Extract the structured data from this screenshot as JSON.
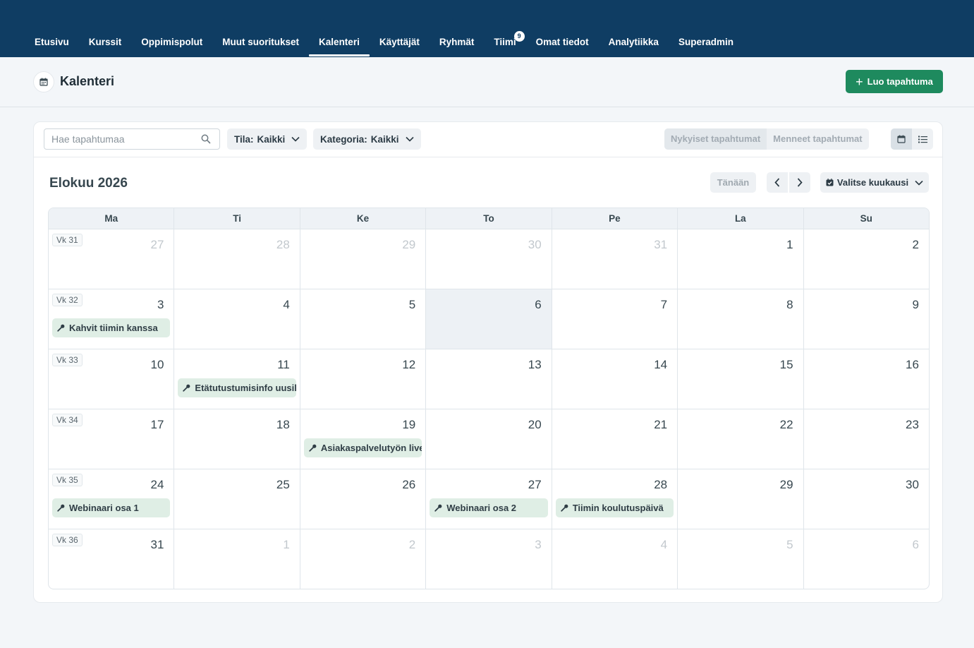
{
  "nav": {
    "items": [
      {
        "label": "Etusivu"
      },
      {
        "label": "Kurssit"
      },
      {
        "label": "Oppimispolut"
      },
      {
        "label": "Muut suoritukset"
      },
      {
        "label": "Kalenteri",
        "active": true
      },
      {
        "label": "Käyttäjät"
      },
      {
        "label": "Ryhmät"
      },
      {
        "label": "Tiimi",
        "badge": "9"
      },
      {
        "label": "Omat tiedot"
      },
      {
        "label": "Analytiikka"
      },
      {
        "label": "Superadmin"
      }
    ]
  },
  "header": {
    "title": "Kalenteri",
    "icon": "calendar-icon",
    "create_label": "Luo tapahtuma"
  },
  "toolbar": {
    "search_placeholder": "Hae tapahtumaa",
    "status_filter": {
      "label": "Tila:",
      "value": "Kaikki"
    },
    "category_filter": {
      "label": "Kategoria:",
      "value": "Kaikki"
    },
    "current_events": "Nykyiset tapahtumat",
    "past_events": "Menneet tapahtumat"
  },
  "calendar": {
    "month_title": "Elokuu 2026",
    "today_label": "Tänään",
    "month_select_label": "Valitse kuukausi",
    "weekdays": [
      "Ma",
      "Ti",
      "Ke",
      "To",
      "Pe",
      "La",
      "Su"
    ],
    "weeks": [
      {
        "label": "Vk 31",
        "days": [
          {
            "n": "27",
            "other": true
          },
          {
            "n": "28",
            "other": true
          },
          {
            "n": "29",
            "other": true
          },
          {
            "n": "30",
            "other": true
          },
          {
            "n": "31",
            "other": true
          },
          {
            "n": "1"
          },
          {
            "n": "2"
          }
        ]
      },
      {
        "label": "Vk 32",
        "days": [
          {
            "n": "3",
            "event": "Kahvit tiimin kanssa"
          },
          {
            "n": "4"
          },
          {
            "n": "5"
          },
          {
            "n": "6",
            "today": true
          },
          {
            "n": "7"
          },
          {
            "n": "8"
          },
          {
            "n": "9"
          }
        ]
      },
      {
        "label": "Vk 33",
        "days": [
          {
            "n": "10"
          },
          {
            "n": "11",
            "event": "Etätutustumisinfo uusille"
          },
          {
            "n": "12"
          },
          {
            "n": "13"
          },
          {
            "n": "14"
          },
          {
            "n": "15"
          },
          {
            "n": "16"
          }
        ]
      },
      {
        "label": "Vk 34",
        "days": [
          {
            "n": "17"
          },
          {
            "n": "18"
          },
          {
            "n": "19",
            "event": "Asiakaspalvelutyön live"
          },
          {
            "n": "20"
          },
          {
            "n": "21"
          },
          {
            "n": "22"
          },
          {
            "n": "23"
          }
        ]
      },
      {
        "label": "Vk 35",
        "days": [
          {
            "n": "24",
            "event": "Webinaari osa 1"
          },
          {
            "n": "25"
          },
          {
            "n": "26"
          },
          {
            "n": "27",
            "event": "Webinaari osa 2"
          },
          {
            "n": "28",
            "event": "Tiimin koulutuspäivä"
          },
          {
            "n": "29"
          },
          {
            "n": "30"
          }
        ]
      },
      {
        "label": "Vk 36",
        "days": [
          {
            "n": "31"
          },
          {
            "n": "1",
            "other": true
          },
          {
            "n": "2",
            "other": true
          },
          {
            "n": "3",
            "other": true
          },
          {
            "n": "4",
            "other": true
          },
          {
            "n": "5",
            "other": true
          },
          {
            "n": "6",
            "other": true
          }
        ]
      }
    ]
  },
  "colors": {
    "nav_bg": "#0f3d63",
    "primary_button": "#1e8a5e",
    "event_bg": "#dfeee5",
    "today_bg": "#edf1f5"
  }
}
